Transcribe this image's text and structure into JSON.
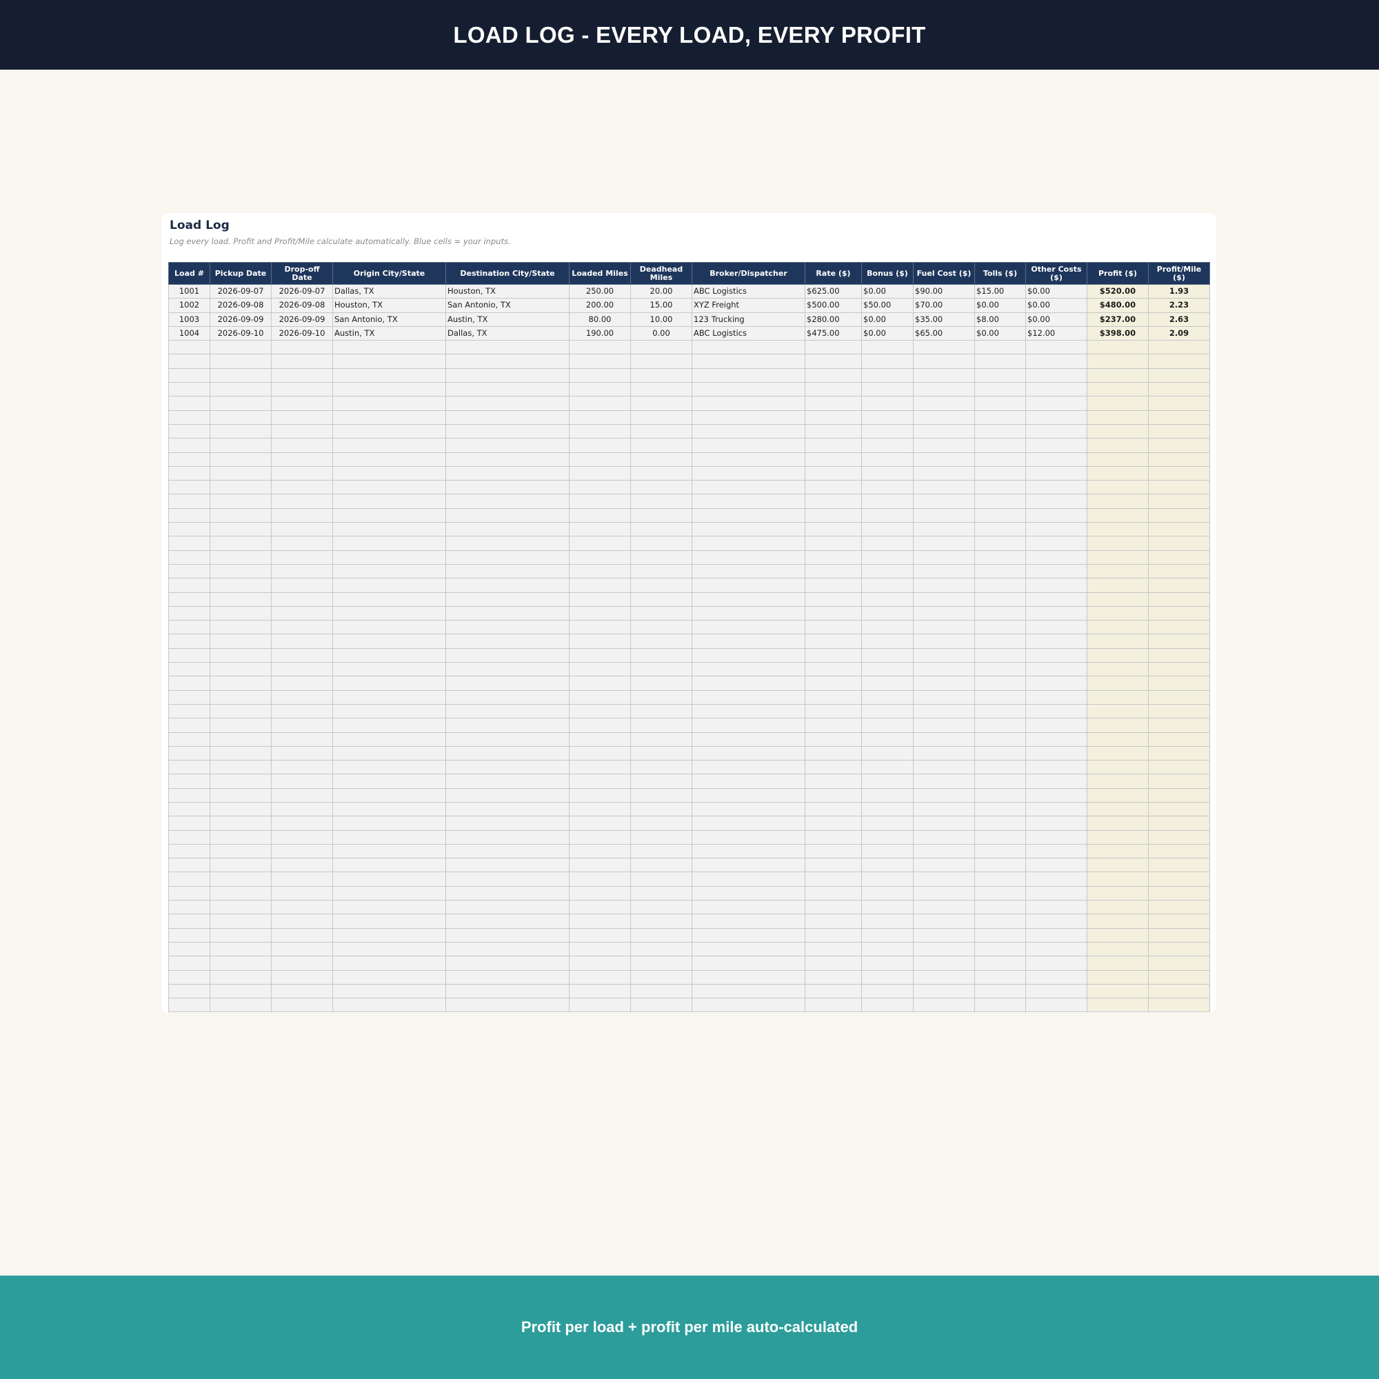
{
  "header": {
    "title": "LOAD LOG - EVERY LOAD, EVERY PROFIT"
  },
  "footer": {
    "text": "Profit per load + profit per mile auto-calculated"
  },
  "sheet": {
    "title": "Load Log",
    "subtitle": "Log every load. Profit and Profit/Mile calculate automatically. Blue cells = your inputs.",
    "columns": [
      "Load #",
      "Pickup Date",
      "Drop-off Date",
      "Origin City/State",
      "Destination City/State",
      "Loaded Miles",
      "Deadhead Miles",
      "Broker/Dispatcher",
      "Rate ($)",
      "Bonus ($)",
      "Fuel Cost ($)",
      "Tolls ($)",
      "Other Costs ($)",
      "Profit ($)",
      "Profit/Mile ($)"
    ],
    "rows": [
      [
        "1001",
        "2026-09-07",
        "2026-09-07",
        "Dallas, TX",
        "Houston, TX",
        "250.00",
        "20.00",
        "ABC Logistics",
        "$625.00",
        "$0.00",
        "$90.00",
        "$15.00",
        "$0.00",
        "$520.00",
        "1.93"
      ],
      [
        "1002",
        "2026-09-08",
        "2026-09-08",
        "Houston, TX",
        "San Antonio, TX",
        "200.00",
        "15.00",
        "XYZ Freight",
        "$500.00",
        "$50.00",
        "$70.00",
        "$0.00",
        "$0.00",
        "$480.00",
        "2.23"
      ],
      [
        "1003",
        "2026-09-09",
        "2026-09-09",
        "San Antonio, TX",
        "Austin, TX",
        "80.00",
        "10.00",
        "123 Trucking",
        "$280.00",
        "$0.00",
        "$35.00",
        "$8.00",
        "$0.00",
        "$237.00",
        "2.63"
      ],
      [
        "1004",
        "2026-09-10",
        "2026-09-10",
        "Austin, TX",
        "Dallas, TX",
        "190.00",
        "0.00",
        "ABC Logistics",
        "$475.00",
        "$0.00",
        "$65.00",
        "$0.00",
        "$12.00",
        "$398.00",
        "2.09"
      ]
    ],
    "empty_row_count": 48,
    "colors": {
      "banner": "#151e31",
      "header_fill": "#1f365c",
      "input_cell": "#f2f2f2",
      "calc_cell": "#f3f1de",
      "profit_mile_text": "#2c9a7b",
      "footer": "#2c9d9b"
    }
  }
}
